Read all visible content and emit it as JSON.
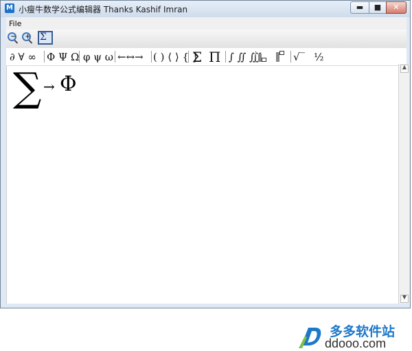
{
  "window": {
    "app_icon_letter": "M",
    "title": "小瘦牛数学公式编辑器 Thanks Kashif Imran",
    "controls": {
      "minimize": "▬",
      "maximize": "■",
      "close": "✕"
    }
  },
  "menubar": {
    "file": "File"
  },
  "toolbar": {
    "zoom_out_icon": "zoom-out-icon",
    "zoom_in_icon": "zoom-in-icon",
    "formula_toggle": "Σ"
  },
  "symbols": {
    "group1": "∂ ∀ ∞",
    "group2": "Φ Ψ Ω",
    "group3": "φ ψ ω",
    "group4": "←↔→",
    "group5": "( ) ⟨ ⟩ { }",
    "sum": "Σ",
    "product": "Π",
    "integrals": "∫ ∬ ∭",
    "sqrt": "√‾",
    "fraction": "½"
  },
  "editor": {
    "sigma": "∑",
    "arrow": "→",
    "phi": "Φ"
  },
  "watermark": {
    "name": "多多软件站",
    "domain": "ddooo.com"
  },
  "colors": {
    "accent": "#1e78c9",
    "titlebar": "#dfe9f5"
  }
}
